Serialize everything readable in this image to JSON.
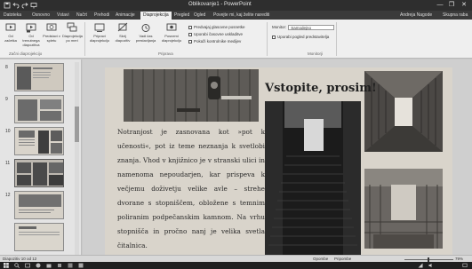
{
  "window": {
    "title": "Oblikovanje1 - PowerPoint",
    "qa_icons": [
      "save-icon",
      "undo-icon",
      "redo-icon",
      "present-icon"
    ],
    "controls": [
      "—",
      "❐",
      "✕"
    ]
  },
  "tabs": [
    {
      "label": "Datoteka",
      "active": false
    },
    {
      "label": "Osnovno",
      "active": false
    },
    {
      "label": "Vstavi",
      "active": false
    },
    {
      "label": "Načrt",
      "active": false
    },
    {
      "label": "Prehodi",
      "active": false
    },
    {
      "label": "Animacije",
      "active": false
    },
    {
      "label": "Diaprojekcija",
      "active": true
    },
    {
      "label": "Pregled",
      "active": false
    },
    {
      "label": "Ogled",
      "active": false
    },
    {
      "label": "Povejte mi, kaj želite narediti",
      "active": false
    }
  ],
  "user": {
    "name": "Andreja Nagode",
    "share": "Skupna raba"
  },
  "ribbon": {
    "buttons": [
      {
        "label": "Od začetka",
        "icon": "play-start-icon"
      },
      {
        "label": "Od trenutnega diapozitiva",
        "icon": "play-current-icon"
      },
      {
        "label": "Predstavi v spletu",
        "icon": "present-online-icon"
      },
      {
        "label": "Diaprojekcija po meri",
        "icon": "custom-show-icon"
      },
      {
        "label": "Pripravi diaprojekcijo",
        "icon": "setup-show-icon"
      },
      {
        "label": "Skrij diapozitiv",
        "icon": "hide-slide-icon"
      },
      {
        "label": "Vadi čas prestavljanja",
        "icon": "rehearse-timings-icon"
      },
      {
        "label": "Posnemi diaprojekcijo",
        "icon": "record-show-icon"
      }
    ],
    "groups": [
      "Začni diaprojekcijo",
      "Priprava",
      "Monitorji"
    ],
    "checkboxes": [
      "Predvajaj glasovne posnetke",
      "Uporabi časovne uskladitve",
      "Pokaži kontrolnike medijev"
    ],
    "monitor_label": "Monitor:",
    "monitor_value": "Samodejno",
    "presenter_view": "Uporabi pogled predstavitelja"
  },
  "thumbnails": [
    {
      "number": "8"
    },
    {
      "number": "9"
    },
    {
      "number": "10"
    },
    {
      "number": "11"
    },
    {
      "number": "12"
    }
  ],
  "slide": {
    "title": "Vstopite, prosim!",
    "body": "Notranjost je zasnovana kot »pot k učenosti«, pot iz teme neznanja k svetlobi znanja. Vhod v knjižnico je v stranski ulici in namenoma nepoudarjen, kar prispeva k večjemu doživetju velike avle – strehe dvorane s stopniščem, obložene s temnim poliranim podpečanskim kamnom. Na vrhu stopnišča in pročno nanj je velika svetla čitalnica."
  },
  "status": {
    "slide_info": "Diapozitiv 10 od 12",
    "notes": "Opombe",
    "comments": "Pripombe",
    "zoom": "79%"
  },
  "colors": {
    "titlebar": "#2e2e2e",
    "ribbon": "#efefef",
    "slide_bg": "#d9d4cb"
  }
}
